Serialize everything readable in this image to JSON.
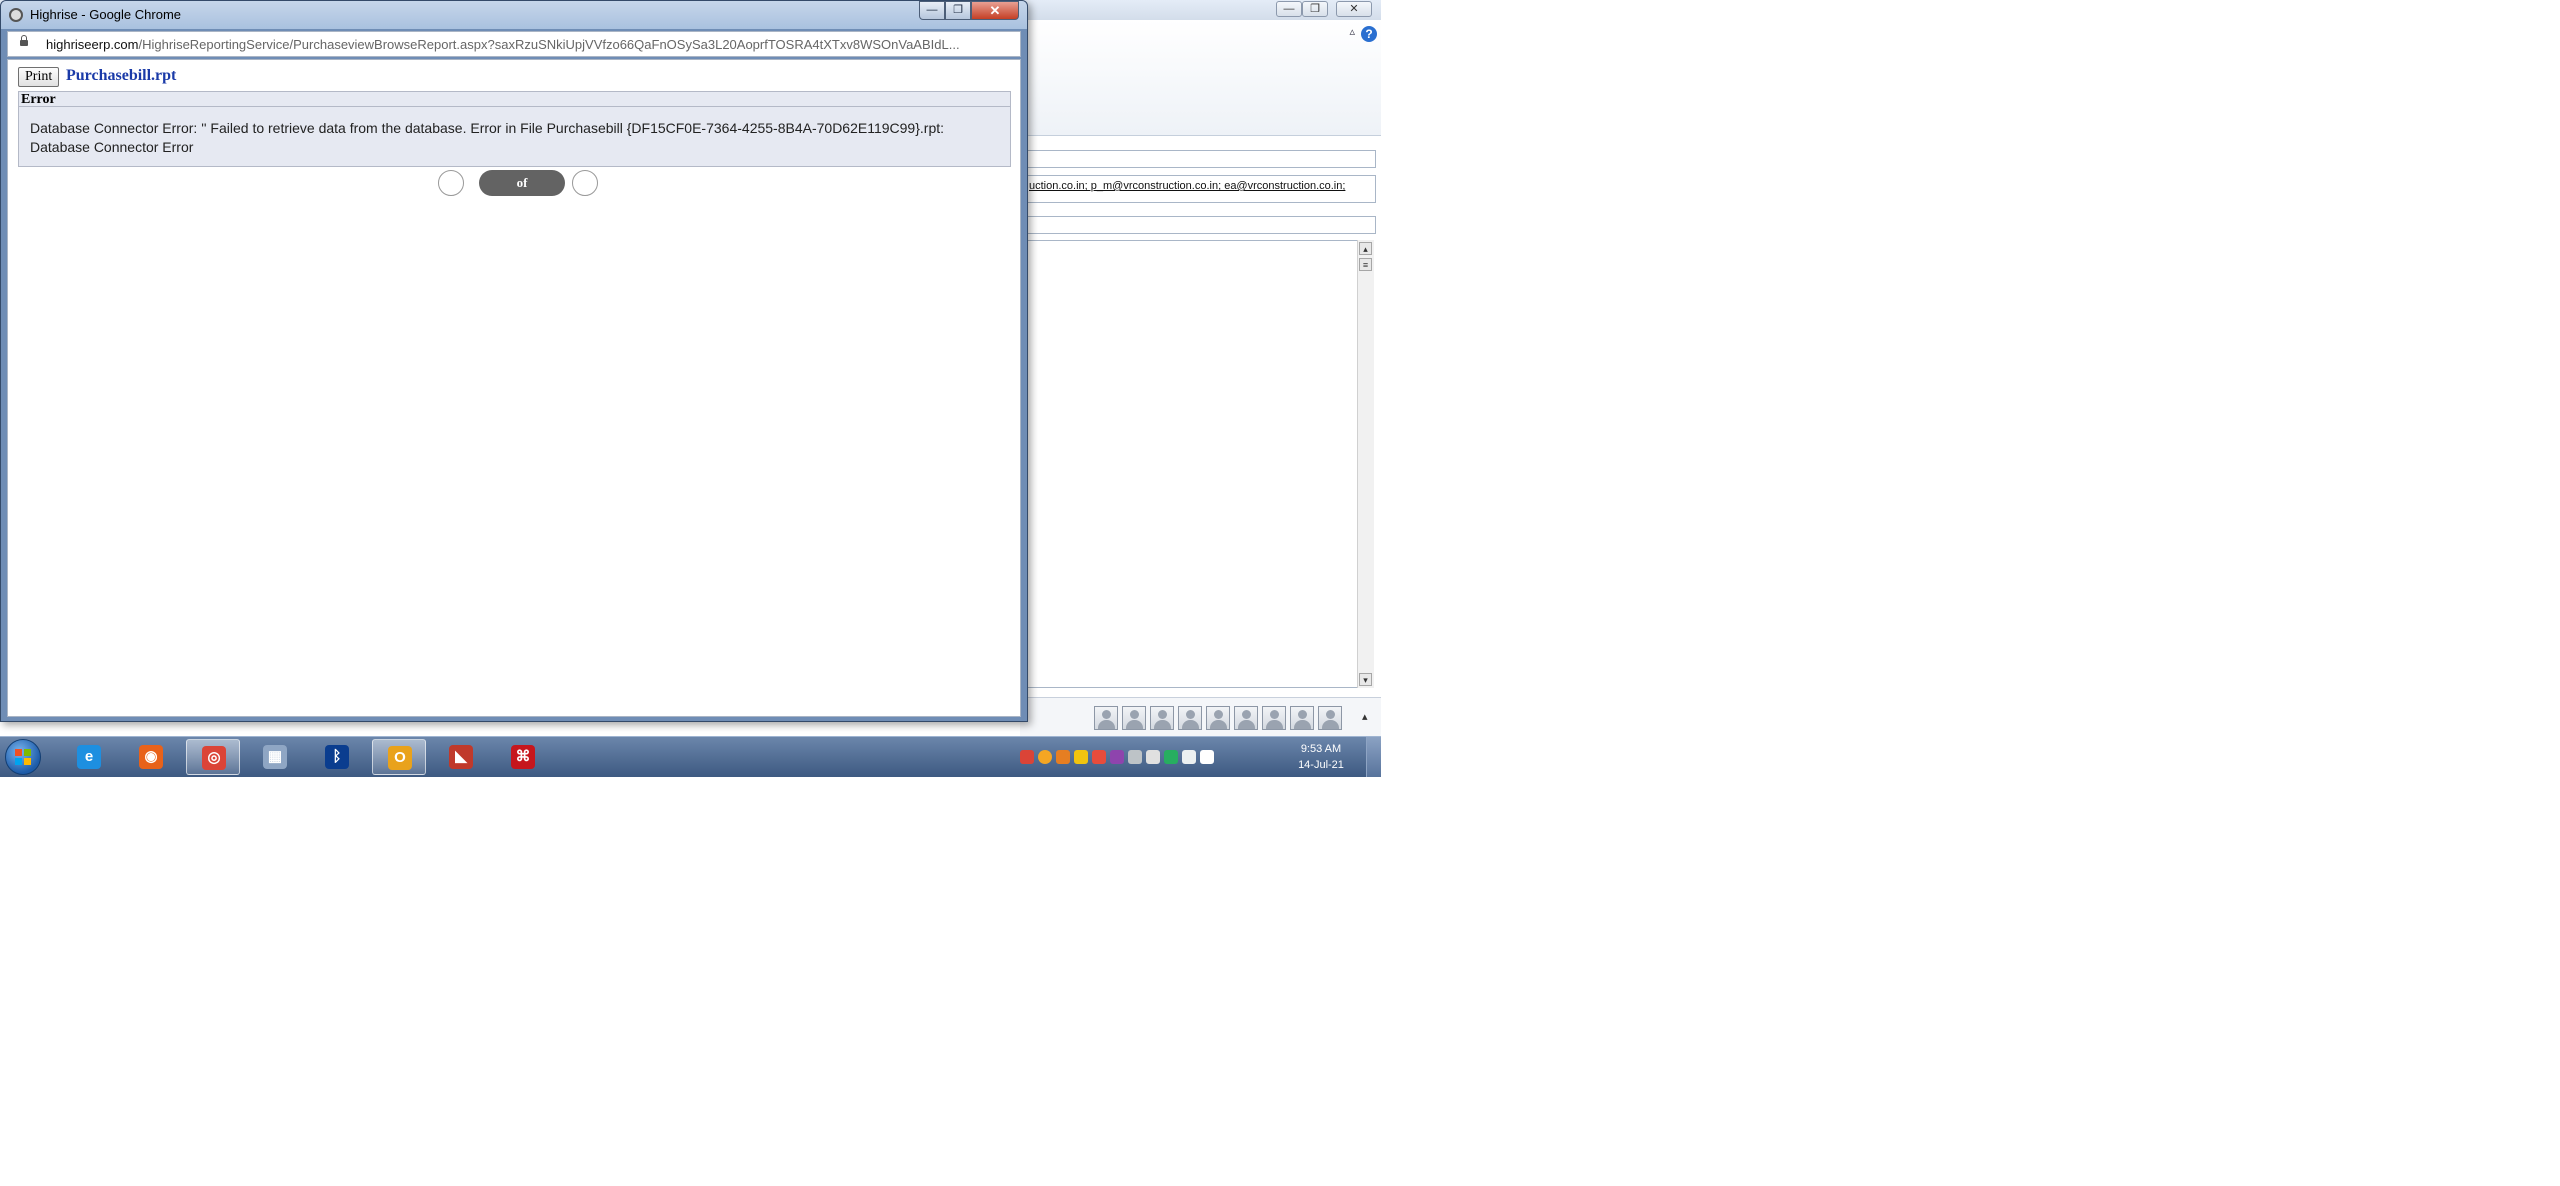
{
  "background_window": {
    "to_recipients": "uction.co.in; p_m@vrconstruction.co.in; ea@vrconstruction.co.in;",
    "help_glyph": "?",
    "caret_glyph": "▵"
  },
  "popup": {
    "title": "Highrise - Google Chrome",
    "address": {
      "domain": "highriseerp.com",
      "path": "/HighriseReportingService/PurchaseviewBrowseReport.aspx?saxRzuSNkiUpjVVfzo66QaFnOSySa3L20AoprfTOSRA4tXTxv8WSOnVaABIdL..."
    },
    "print_label": "Print",
    "report_name": "Purchasebill.rpt",
    "error_heading": "Error",
    "error_message": "Database Connector Error: '' Failed to retrieve data from the database. Error in File Purchasebill {DF15CF0E-7364-4255-8B4A-70D62E119C99}.rpt: Database Connector Error",
    "pager_label": "of"
  },
  "taskbar": {
    "apps": [
      {
        "name": "internet-explorer-icon",
        "glyph": "e",
        "color": "#1d8fe0"
      },
      {
        "name": "firefox-icon",
        "glyph": "◉",
        "color": "#e8621a"
      },
      {
        "name": "chrome-icon",
        "glyph": "◎",
        "color": "#db4437"
      },
      {
        "name": "calculator-icon",
        "glyph": "▦",
        "color": "#8fa6c4"
      },
      {
        "name": "bluetooth-icon",
        "glyph": "ᛒ",
        "color": "#0a3d8f"
      },
      {
        "name": "outlook-icon",
        "glyph": "O",
        "color": "#e9a21b"
      },
      {
        "name": "chart-app-icon",
        "glyph": "◣",
        "color": "#c0392b"
      },
      {
        "name": "pdf-reader-icon",
        "glyph": "⌘",
        "color": "#c6161d"
      }
    ],
    "clock_time": "9:53 AM",
    "clock_date": "14-Jul-21"
  }
}
